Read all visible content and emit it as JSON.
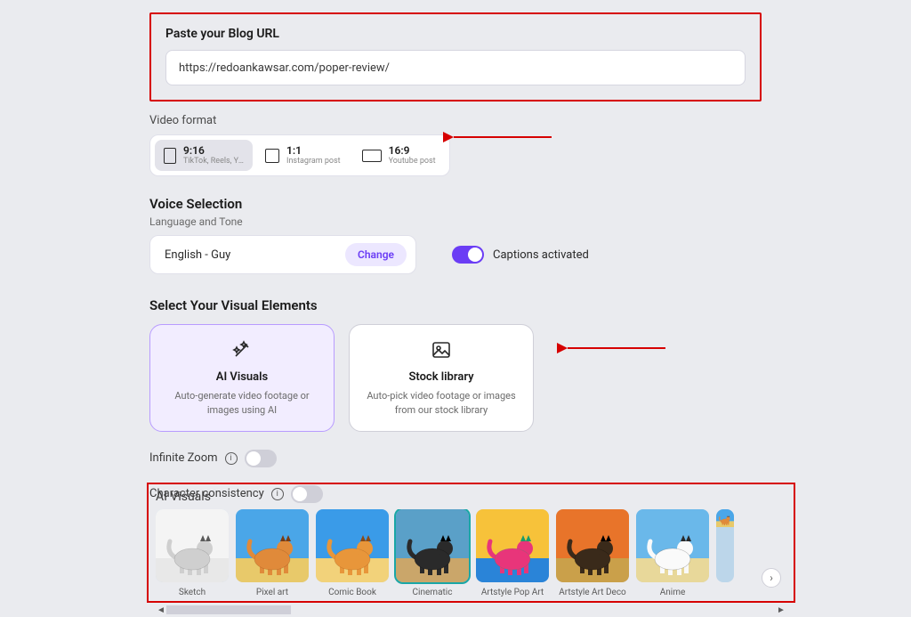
{
  "url_section": {
    "label": "Paste your Blog URL",
    "value": "https://redoankawsar.com/poper-review/"
  },
  "video_format": {
    "label": "Video format",
    "options": [
      {
        "ratio": "9:16",
        "desc": "TikTok, Reels, Youtu..",
        "selected": true
      },
      {
        "ratio": "1:1",
        "desc": "Instagram post",
        "selected": false
      },
      {
        "ratio": "16:9",
        "desc": "Youtube post",
        "selected": false
      }
    ]
  },
  "voice": {
    "heading": "Voice Selection",
    "sub": "Language and Tone",
    "value": "English - Guy",
    "change_label": "Change",
    "captions_label": "Captions activated",
    "captions_on": true
  },
  "visual_elements": {
    "heading": "Select Your Visual Elements",
    "cards": [
      {
        "title": "AI Visuals",
        "desc": "Auto-generate video footage or images using AI",
        "selected": true,
        "icon": "wand"
      },
      {
        "title": "Stock library",
        "desc": "Auto-pick video footage or images from our stock library",
        "selected": false,
        "icon": "image"
      }
    ]
  },
  "toggles": {
    "infinite_zoom": {
      "label": "Infinite Zoom",
      "on": false
    },
    "char_consistency": {
      "label": "Character consistency",
      "on": false
    }
  },
  "ai_visuals": {
    "heading": "AI Visuals",
    "styles": [
      {
        "label": "Sketch",
        "selected": false,
        "palette": "sketch"
      },
      {
        "label": "Pixel art",
        "selected": false,
        "palette": "pixel"
      },
      {
        "label": "Comic Book",
        "selected": false,
        "palette": "comic"
      },
      {
        "label": "Cinematic",
        "selected": true,
        "palette": "cinematic"
      },
      {
        "label": "Artstyle Pop Art",
        "selected": false,
        "palette": "popart"
      },
      {
        "label": "Artstyle Art Deco",
        "selected": false,
        "palette": "artdeco"
      },
      {
        "label": "Anime",
        "selected": false,
        "palette": "anime"
      }
    ]
  }
}
